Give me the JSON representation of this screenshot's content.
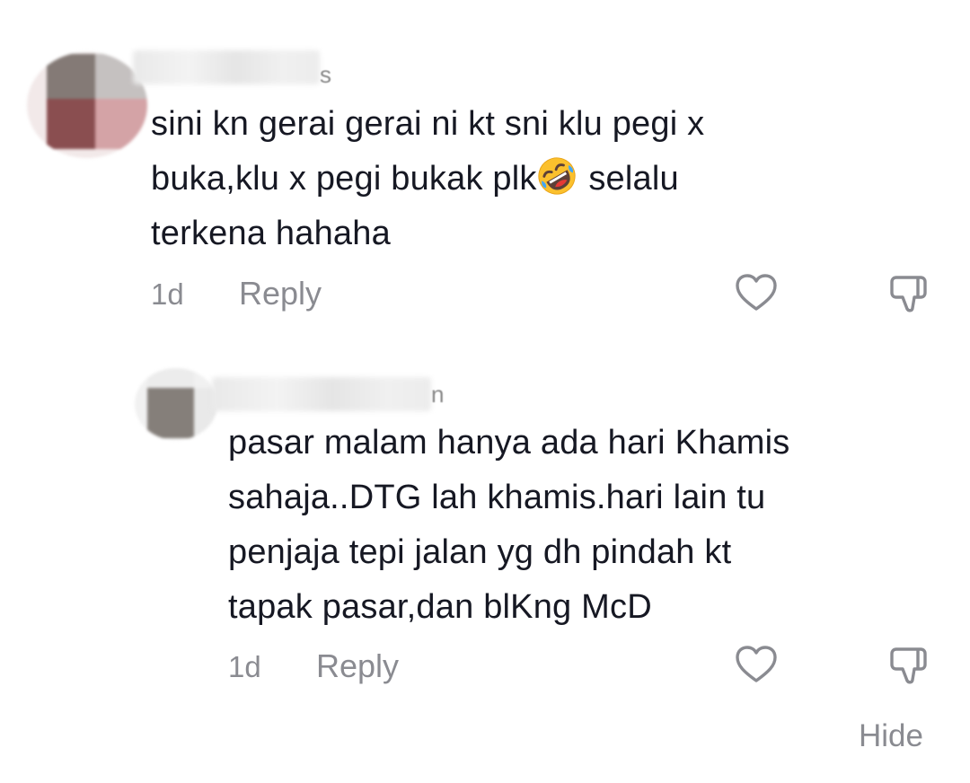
{
  "comments": [
    {
      "username_tail": "s",
      "text": "sini kn gerai gerai ni kt sni klu pegi x\nbuka,klu x pegi bukak plk",
      "emoji_icon": "rolling-on-floor-laughing-emoji",
      "text_after_emoji": " selalu\nterkena hahaha",
      "time": "1d",
      "reply_label": "Reply",
      "like_icon": "heart-outline-icon",
      "dislike_icon": "thumbs-down-outline-icon"
    },
    {
      "username_tail": "n",
      "text": "pasar malam hanya ada hari Khamis\nsahaja..DTG lah khamis.hari lain tu\npenjaja tepi jalan yg dh pindah kt\ntapak pasar,dan blKng McD",
      "time": "1d",
      "reply_label": "Reply",
      "like_icon": "heart-outline-icon",
      "dislike_icon": "thumbs-down-outline-icon"
    }
  ],
  "footer": {
    "hide_label": "Hide"
  },
  "colors": {
    "text": "#161823",
    "meta": "#8a8b91",
    "background": "#ffffff"
  }
}
